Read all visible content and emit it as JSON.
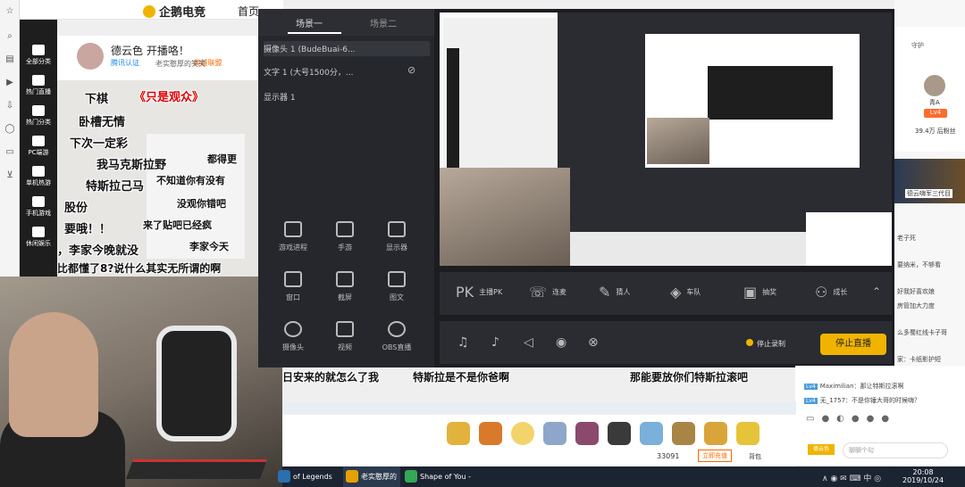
{
  "site": {
    "logo": "企鹅电竞",
    "nav_first": "首页"
  },
  "categories": [
    {
      "label": "全部分类"
    },
    {
      "label": "热门直播"
    },
    {
      "label": "热门分类"
    },
    {
      "label": "PC端游"
    },
    {
      "label": "单机热游"
    },
    {
      "label": "手机游戏"
    },
    {
      "label": "休闲娱乐"
    }
  ],
  "room": {
    "title": "德云色 开播咯！",
    "subtitle": "老实憨厚的笑笑",
    "tags": [
      "腾讯认证",
      "英雄联盟"
    ]
  },
  "danmu_left": [
    "下棋",
    "《只是观众》",
    "卧槽无情",
    "下次一定彩",
    "我马克斯拉野",
    "特斯拉己马",
    "股份",
    "要哦！！",
    "，李家今晚就没",
    "比都懂了8?说什么其实无所谓的啊",
    "不知道你有没有",
    "没观你错吧",
    "来了贴吧已经疯",
    "李家今天",
    "都得更"
  ],
  "obs": {
    "scene_tabs": [
      "场景一",
      "场景二"
    ],
    "sources": [
      "摄像头 1 (BudeBuai-6...",
      "文字 1 (大号1500分，...",
      "显示器 1"
    ],
    "tools": [
      {
        "label": "游戏进程",
        "icon": "gamepad-icon"
      },
      {
        "label": "手游",
        "icon": "phone-icon"
      },
      {
        "label": "显示器",
        "icon": "monitor-icon"
      },
      {
        "label": "窗口",
        "icon": "window-icon"
      },
      {
        "label": "截屏",
        "icon": "screenshot-icon"
      },
      {
        "label": "图文",
        "icon": "image-icon"
      },
      {
        "label": "摄像头",
        "icon": "camera-icon"
      },
      {
        "label": "视频",
        "icon": "video-icon"
      },
      {
        "label": "OBS直播",
        "icon": "obs-icon"
      }
    ],
    "controls": [
      {
        "label": "主播PK",
        "glyph": "PK"
      },
      {
        "label": "连麦",
        "glyph": "☏"
      },
      {
        "label": "猜人",
        "glyph": "✎"
      },
      {
        "label": "车队",
        "glyph": "◈"
      },
      {
        "label": "抽奖",
        "glyph": "▣"
      },
      {
        "label": "成长",
        "glyph": "⚇"
      }
    ],
    "stop_record": "停止录制",
    "stop_live": "停止直播"
  },
  "streamer_card": {
    "guard_label": "守护",
    "name": "青A",
    "level": "Lv4",
    "fans": "39.4万 后粉丝"
  },
  "ad": {
    "text": "德云嗨军三代目"
  },
  "chat": [
    {
      "text": "老子死",
      "level": ""
    },
    {
      "text": "要纳米，不够看",
      "level": ""
    },
    {
      "text": "好我好喜欢娘",
      "level": ""
    },
    {
      "text": "房管加大力度",
      "level": ""
    },
    {
      "text": "么多蜀红线卡子哥",
      "level": ""
    },
    {
      "text": "家：卡纸影护短",
      "level": ""
    },
    {
      "text": "Maximilian：那让特斯拉滚啊",
      "level": "Lv4"
    },
    {
      "text": "无_1757：不是你锤大哥的时候嗨？",
      "level": "Lv4"
    }
  ],
  "chat_input_placeholder": "聊聊个句",
  "chat_user_badge": "德云色",
  "danmu_bottom": [
    "日安来的就怎么了我",
    "特斯拉是不是你爸啊",
    "那能要放你们特斯拉滚吧"
  ],
  "gift": {
    "coins": "33091",
    "recharge": "立即充值",
    "backpack": "背包"
  },
  "taskbar": {
    "items": [
      {
        "label": "of Legends",
        "color": "#2a6fb0"
      },
      {
        "label": "老实憨厚的笑笑 直...",
        "color": "#e6a100"
      },
      {
        "label": "Shape of You - E...",
        "color": "#34a853"
      }
    ],
    "time": "20:08",
    "date": "2019/10/24",
    "tray": "∧  ◉  ✉  ⌨  中  ◎"
  }
}
